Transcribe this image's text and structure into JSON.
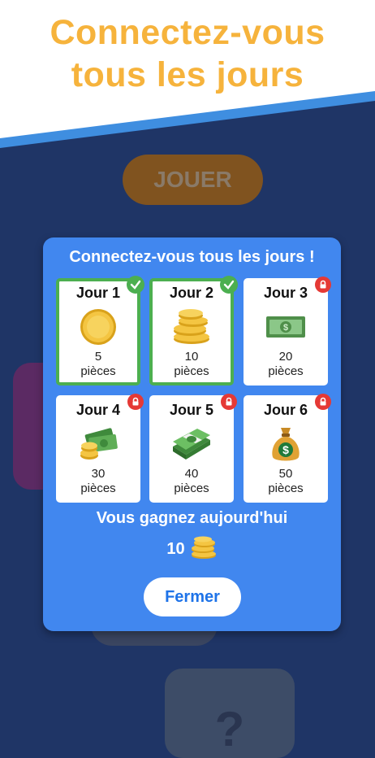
{
  "banner": {
    "line1": "Connectez-vous",
    "line2": "tous les jours"
  },
  "background": {
    "play_label": "JOUER",
    "tile_label": "?"
  },
  "modal": {
    "title": "Connectez-vous tous les jours !",
    "days": [
      {
        "label": "Jour 1",
        "amount": "5",
        "unit": "pièces",
        "status": "claimed",
        "icon": "coin-icon"
      },
      {
        "label": "Jour 2",
        "amount": "10",
        "unit": "pièces",
        "status": "claimed",
        "icon": "coin-stack-icon"
      },
      {
        "label": "Jour 3",
        "amount": "20",
        "unit": "pièces",
        "status": "locked",
        "icon": "banknote-icon"
      },
      {
        "label": "Jour 4",
        "amount": "30",
        "unit": "pièces",
        "status": "locked",
        "icon": "cash-and-coins-icon"
      },
      {
        "label": "Jour 5",
        "amount": "40",
        "unit": "pièces",
        "status": "locked",
        "icon": "cash-bundle-icon"
      },
      {
        "label": "Jour 6",
        "amount": "50",
        "unit": "pièces",
        "status": "locked",
        "icon": "money-bag-icon"
      }
    ],
    "gain_text": "Vous gagnez aujourd'hui",
    "gain_value": "10",
    "close_label": "Fermer"
  },
  "colors": {
    "background": "#1f3566",
    "banner_text": "#f6b33c",
    "modal": "#4187ef",
    "claimed": "#4caf50",
    "locked": "#e53935",
    "close_text": "#1e73e8"
  }
}
